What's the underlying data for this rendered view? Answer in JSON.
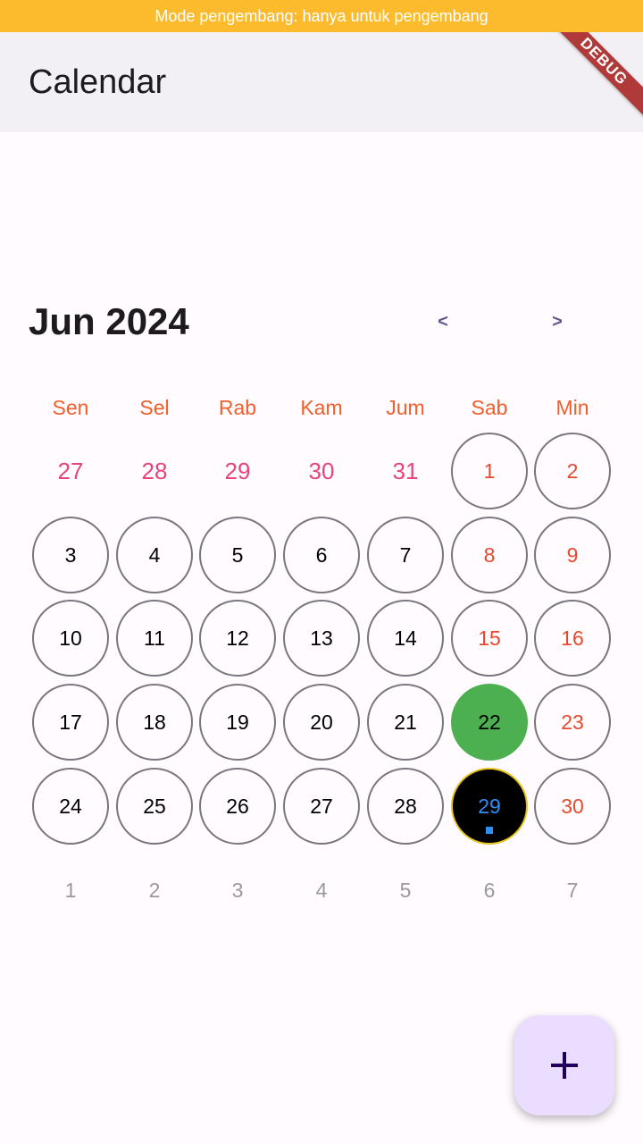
{
  "banner": {
    "text": "Mode pengembang: hanya untuk pengembang"
  },
  "debug_ribbon": {
    "text": "DEBUG"
  },
  "app_bar": {
    "title": "Calendar"
  },
  "calendar": {
    "month_title": "Jun 2024",
    "prev_label": "<",
    "next_label": ">",
    "weekdays": [
      "Sen",
      "Sel",
      "Rab",
      "Kam",
      "Jum",
      "Sab",
      "Min"
    ],
    "weeks": [
      [
        "27",
        "28",
        "29",
        "30",
        "31",
        "1",
        "2"
      ],
      [
        "3",
        "4",
        "5",
        "6",
        "7",
        "8",
        "9"
      ],
      [
        "10",
        "11",
        "12",
        "13",
        "14",
        "15",
        "16"
      ],
      [
        "17",
        "18",
        "19",
        "20",
        "21",
        "22",
        "23"
      ],
      [
        "24",
        "25",
        "26",
        "27",
        "28",
        "29",
        "30"
      ],
      [
        "1",
        "2",
        "3",
        "4",
        "5",
        "6",
        "7"
      ]
    ],
    "selected_day": "22",
    "today_day": "29",
    "event_days": [
      "29"
    ]
  },
  "fab": {
    "icon": "plus-icon"
  },
  "colors": {
    "banner": "#fbbb2c",
    "weekday": "#f0602c",
    "weekend": "#e64a2e",
    "outside_prev": "#e8447a",
    "outside_next": "#9a9a9a",
    "selected": "#4caf50",
    "today_bg": "#000000",
    "today_border": "#e6c21c",
    "today_text": "#2f8ff5",
    "fab_bg": "#eaddff",
    "nav": "#65558f"
  }
}
